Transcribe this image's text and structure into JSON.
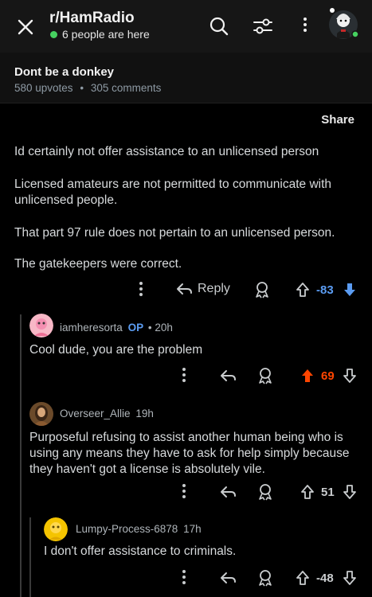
{
  "header": {
    "subreddit": "r/HamRadio",
    "online": "6 people are here"
  },
  "post": {
    "title": "Dont be a donkey",
    "upvotes": "580 upvotes",
    "separator": "•",
    "comments": "305 comments",
    "share": "Share"
  },
  "top_comment": {
    "paragraphs": [
      "Id certainly not offer assistance to an unlicensed person",
      "Licensed amateurs are not permitted to communicate with unlicensed people.",
      "That part 97 rule does not pertain to an unlicensed person.",
      "The gatekeepers were correct."
    ],
    "reply_label": "Reply",
    "score": "-83"
  },
  "replies": [
    {
      "author": "iamheresorta",
      "op_badge": "OP",
      "time": "• 20h",
      "text": "Cool dude, you are the problem",
      "score": "69"
    },
    {
      "author": "Overseer_Allie",
      "time": "19h",
      "text": "Purposeful refusing to assist another human being who is using any means they have to ask for help simply because they haven't got a license is absolutely vile.",
      "score": "51"
    },
    {
      "author": "Lumpy-Process-6878",
      "time": "17h",
      "text": "I don't offer assistance to criminals.",
      "score": "-48"
    }
  ],
  "colors": {
    "upvote_active": "#ff4500",
    "downvote_active": "#5b9cf2",
    "online_dot": "#46d160",
    "op_badge": "#5b9cf2"
  }
}
